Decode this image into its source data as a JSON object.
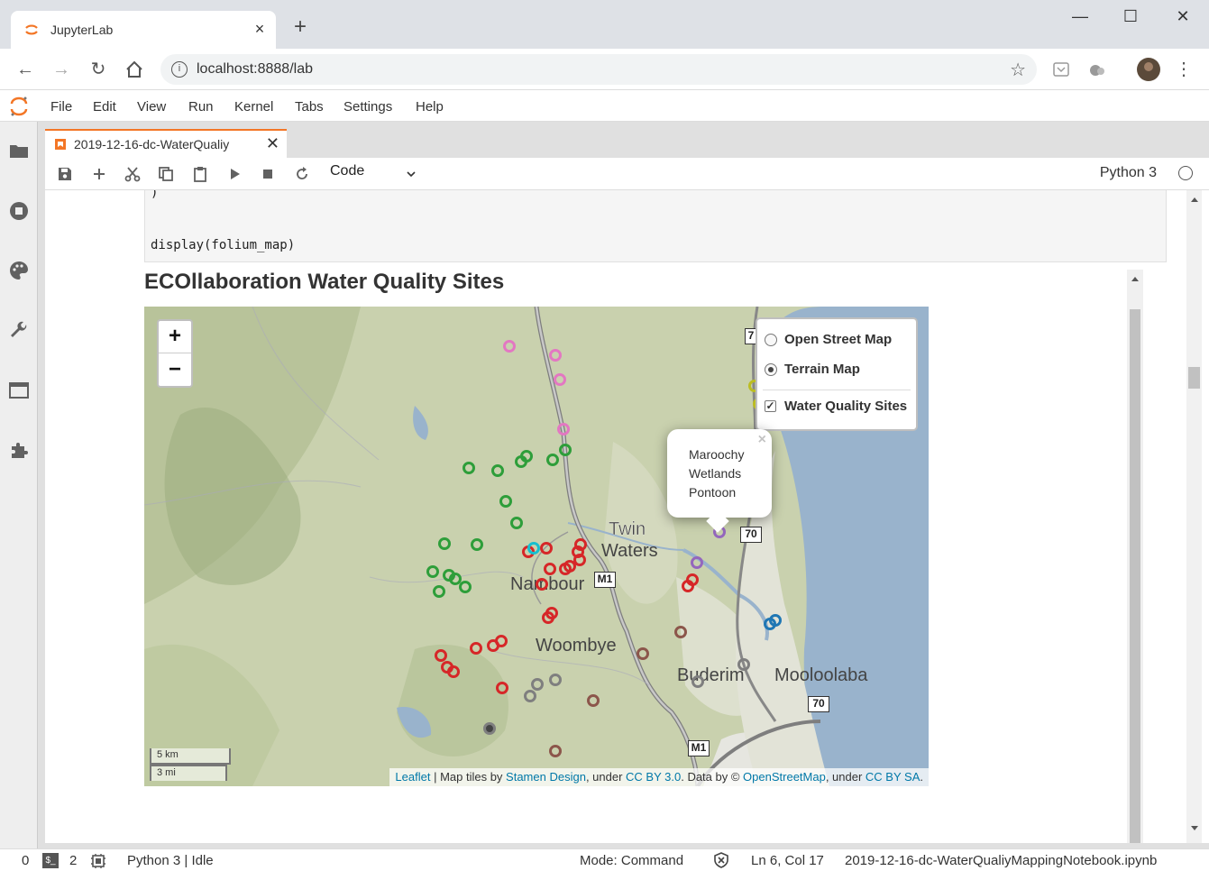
{
  "browser": {
    "tab_title": "JupyterLab",
    "url": "localhost:8888/lab"
  },
  "menubar": {
    "items": [
      "File",
      "Edit",
      "View",
      "Run",
      "Kernel",
      "Tabs",
      "Settings",
      "Help"
    ]
  },
  "document": {
    "tab_title": "2019-12-16-dc-WaterQualiy"
  },
  "toolbar": {
    "cell_type": "Code",
    "kernel_name": "Python 3"
  },
  "code_cell": {
    "lines": [
      ")",
      "",
      "display(folium_map)"
    ]
  },
  "output": {
    "title": "ECOllaboration Water Quality Sites"
  },
  "map": {
    "zoom_in": "+",
    "zoom_out": "−",
    "layers": {
      "base": [
        {
          "label": "Open Street Map",
          "selected": false
        },
        {
          "label": "Terrain Map",
          "selected": true
        }
      ],
      "overlays": [
        {
          "label": "Water Quality Sites",
          "checked": true
        }
      ]
    },
    "popup": {
      "lines": [
        "Maroochy",
        "Wetlands",
        "Pontoon"
      ],
      "close": "×"
    },
    "place_labels": [
      "Twin",
      "Waters",
      "Nambour",
      "Woombye",
      "Buderim",
      "Mooloolaba"
    ],
    "road_labels": [
      "M1",
      "M1",
      "70",
      "70",
      "7"
    ],
    "scale": {
      "km": "5 km",
      "mi": "3 mi"
    },
    "attribution": {
      "leaflet": "Leaflet",
      "t1": " | Map tiles by ",
      "stamen": "Stamen Design",
      "t2": ", under ",
      "ccby": "CC BY 3.0",
      "t3": ". Data by © ",
      "osm": "OpenStreetMap",
      "t4": ", under ",
      "ccbysa": "CC BY SA",
      "t5": "."
    },
    "marker_colors": {
      "green": "#2e9e3a",
      "red": "#d62728",
      "pink": "#e377c2",
      "purple": "#9467bd",
      "blue": "#1f77b4",
      "cyan": "#17becf",
      "brown": "#8c564b",
      "gray": "#7f7f7f",
      "olive": "#bcbd22"
    }
  },
  "statusbar": {
    "terminals": "0",
    "kernels": "2",
    "kernel_status": "Python 3 | Idle",
    "mode": "Mode: Command",
    "position": "Ln 6, Col 17",
    "filename": "2019-12-16-dc-WaterQualiyMappingNotebook.ipynb"
  }
}
